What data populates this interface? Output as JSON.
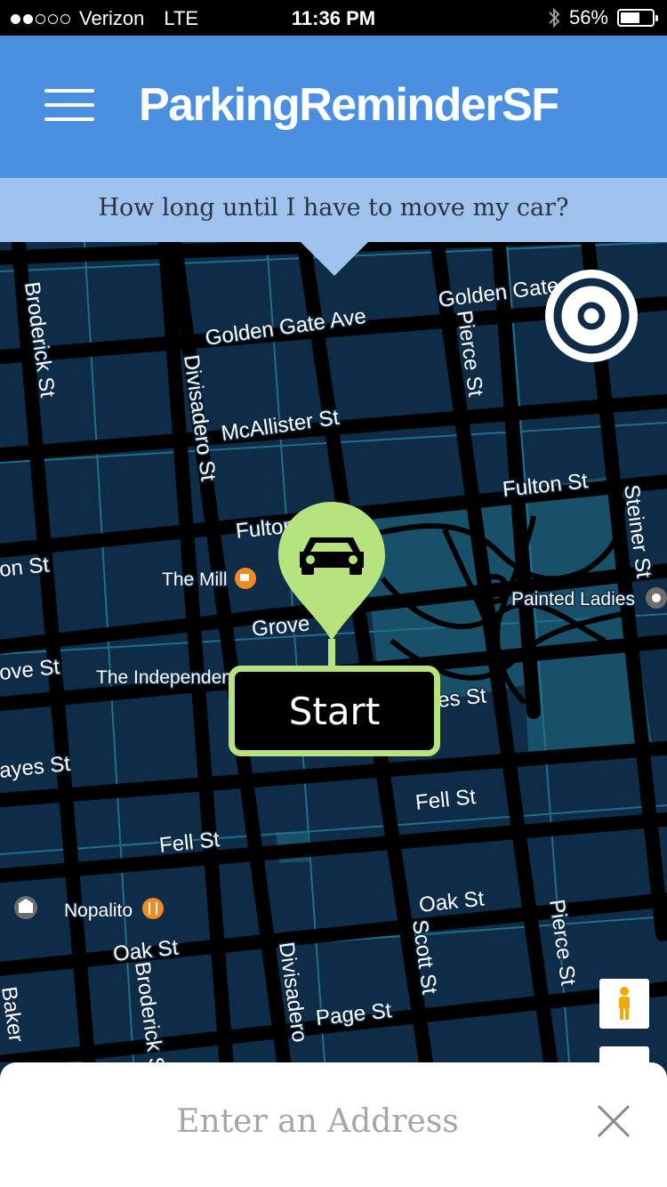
{
  "status_bar": {
    "carrier": "Verizon",
    "network": "LTE",
    "time": "11:36 PM",
    "battery": "56%",
    "signal_bars_filled": 2,
    "signal_bars_total": 5,
    "icons": [
      "bluetooth-icon",
      "battery-icon"
    ]
  },
  "header": {
    "title": "ParkingReminderSF",
    "menu_icon": "hamburger-menu-icon"
  },
  "subheader": {
    "question": "How long until I have to move my car?"
  },
  "map": {
    "streets": {
      "golden_gate_1": "Golden Gate Ave",
      "golden_gate_2": "Golden Gate Ave",
      "broderick_1": "Broderick St",
      "broderick_2": "Broderick St",
      "divisadero_1": "Divisadero St",
      "divisadero_2": "Divisadero",
      "pierce_1": "Pierce St",
      "pierce_2": "Pierce St",
      "mcallister": "McAllister St",
      "fulton_1": "Fulton",
      "fulton_2": "Fulton St",
      "steiner": "Steiner St",
      "grove_1": "Grove",
      "grove_2": "ove St",
      "hayes_1": "es St",
      "hayes_2": "ayes St",
      "on_st": "on St",
      "fell_1": "Fell St",
      "fell_2": "Fell St",
      "oak_1": "Oak St",
      "oak_2": "Oak St",
      "scott": "Scott St",
      "page": "Page St",
      "baker": "Baker"
    },
    "places": {
      "the_mill": "The Mill",
      "painted_ladies": "Painted Ladies",
      "independent": "The Independen",
      "nopalito": "Nopalito"
    },
    "colors": {
      "background": "#0e2c47",
      "road": "#000000",
      "park": "#18506a",
      "pin": "#b6e37e"
    }
  },
  "controls": {
    "locate_icon": "target-icon",
    "street_view_icon": "pegman-icon"
  },
  "start_button": {
    "label": "Start"
  },
  "address": {
    "placeholder": "Enter an Address",
    "value": "",
    "clear_icon": "close-icon"
  }
}
